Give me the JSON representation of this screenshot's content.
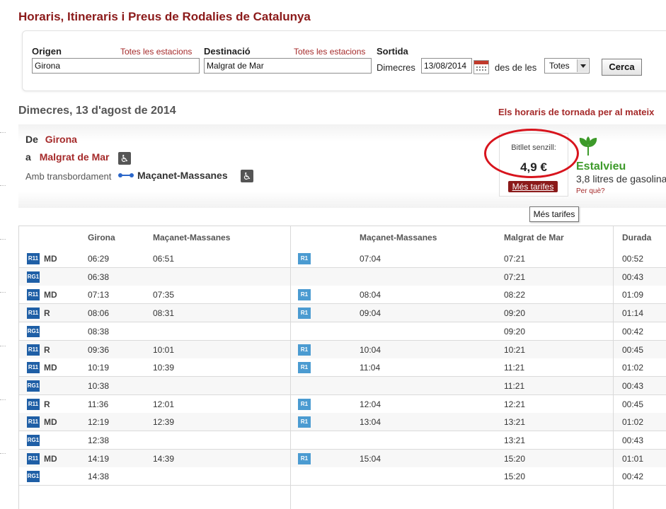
{
  "page": {
    "title": "Horaris, Itineraris i Preus de Rodalies de Catalunya"
  },
  "search": {
    "origin_label": "Origen",
    "origin_all_link": "Totes les estacions",
    "origin_value": "Girona",
    "destination_label": "Destinació",
    "destination_all_link": "Totes les estacions",
    "destination_value": "Malgrat de Mar",
    "departure_label": "Sortida",
    "day_label": "Dimecres",
    "date_value": "13/08/2014",
    "from_label": "des de les",
    "time_select_value": "Totes",
    "search_button": "Cerca",
    "calendar_icon": "calendar-icon"
  },
  "results": {
    "date_heading": "Dimecres, 13 d'agost de 2014",
    "return_link": "Els horaris de tornada per al mateix"
  },
  "route": {
    "from_prefix": "De",
    "from_station": "Girona",
    "to_prefix": "a",
    "to_station": "Malgrat de Mar",
    "transfer_label": "Amb transbordament",
    "transfer_station": "Maçanet-Massanes",
    "access_icon": "wheelchair-accessible-icon"
  },
  "fare": {
    "caption": "Bitllet senzill:",
    "price": "4,9 €",
    "more_fares_button": "Més tarifes",
    "tooltip": "Més tarifes",
    "highlight_color": "#d8141d"
  },
  "eco": {
    "title": "Estalvieu",
    "text": "3,8 litres de gasolina",
    "why_link": "Per què?",
    "icon": "leaf-icon"
  },
  "timetable": {
    "headers": [
      "Girona",
      "Maçanet-Massanes",
      "Maçanet-Massanes",
      "Malgrat de Mar",
      "Durada"
    ],
    "rows": [
      {
        "line": "R11",
        "type": "MD",
        "dep": "06:29",
        "arr_transfer": "06:51",
        "line2": "R1",
        "dep_transfer": "07:04",
        "arr": "07:21",
        "dur": "00:52"
      },
      {
        "line": "RG1",
        "type": "",
        "dep": "06:38",
        "arr_transfer": "",
        "line2": "",
        "dep_transfer": "",
        "arr": "07:21",
        "dur": "00:43"
      },
      {
        "line": "R11",
        "type": "MD",
        "dep": "07:13",
        "arr_transfer": "07:35",
        "line2": "R1",
        "dep_transfer": "08:04",
        "arr": "08:22",
        "dur": "01:09"
      },
      {
        "line": "R11",
        "type": "R",
        "dep": "08:06",
        "arr_transfer": "08:31",
        "line2": "R1",
        "dep_transfer": "09:04",
        "arr": "09:20",
        "dur": "01:14"
      },
      {
        "line": "RG1",
        "type": "",
        "dep": "08:38",
        "arr_transfer": "",
        "line2": "",
        "dep_transfer": "",
        "arr": "09:20",
        "dur": "00:42"
      },
      {
        "line": "R11",
        "type": "R",
        "dep": "09:36",
        "arr_transfer": "10:01",
        "line2": "R1",
        "dep_transfer": "10:04",
        "arr": "10:21",
        "dur": "00:45"
      },
      {
        "line": "R11",
        "type": "MD",
        "dep": "10:19",
        "arr_transfer": "10:39",
        "line2": "R1",
        "dep_transfer": "11:04",
        "arr": "11:21",
        "dur": "01:02"
      },
      {
        "line": "RG1",
        "type": "",
        "dep": "10:38",
        "arr_transfer": "",
        "line2": "",
        "dep_transfer": "",
        "arr": "11:21",
        "dur": "00:43"
      },
      {
        "line": "R11",
        "type": "R",
        "dep": "11:36",
        "arr_transfer": "12:01",
        "line2": "R1",
        "dep_transfer": "12:04",
        "arr": "12:21",
        "dur": "00:45"
      },
      {
        "line": "R11",
        "type": "MD",
        "dep": "12:19",
        "arr_transfer": "12:39",
        "line2": "R1",
        "dep_transfer": "13:04",
        "arr": "13:21",
        "dur": "01:02"
      },
      {
        "line": "RG1",
        "type": "",
        "dep": "12:38",
        "arr_transfer": "",
        "line2": "",
        "dep_transfer": "",
        "arr": "13:21",
        "dur": "00:43"
      },
      {
        "line": "R11",
        "type": "MD",
        "dep": "14:19",
        "arr_transfer": "14:39",
        "line2": "R1",
        "dep_transfer": "15:04",
        "arr": "15:20",
        "dur": "01:01"
      },
      {
        "line": "RG1",
        "type": "",
        "dep": "14:38",
        "arr_transfer": "",
        "line2": "",
        "dep_transfer": "",
        "arr": "15:20",
        "dur": "00:42"
      }
    ]
  },
  "colors": {
    "title": "#8b1a1a",
    "link": "#a52a2a",
    "line_dark": "#1f5fa6",
    "line_light": "#4b9bd1",
    "eco_green": "#3d9a2a"
  }
}
